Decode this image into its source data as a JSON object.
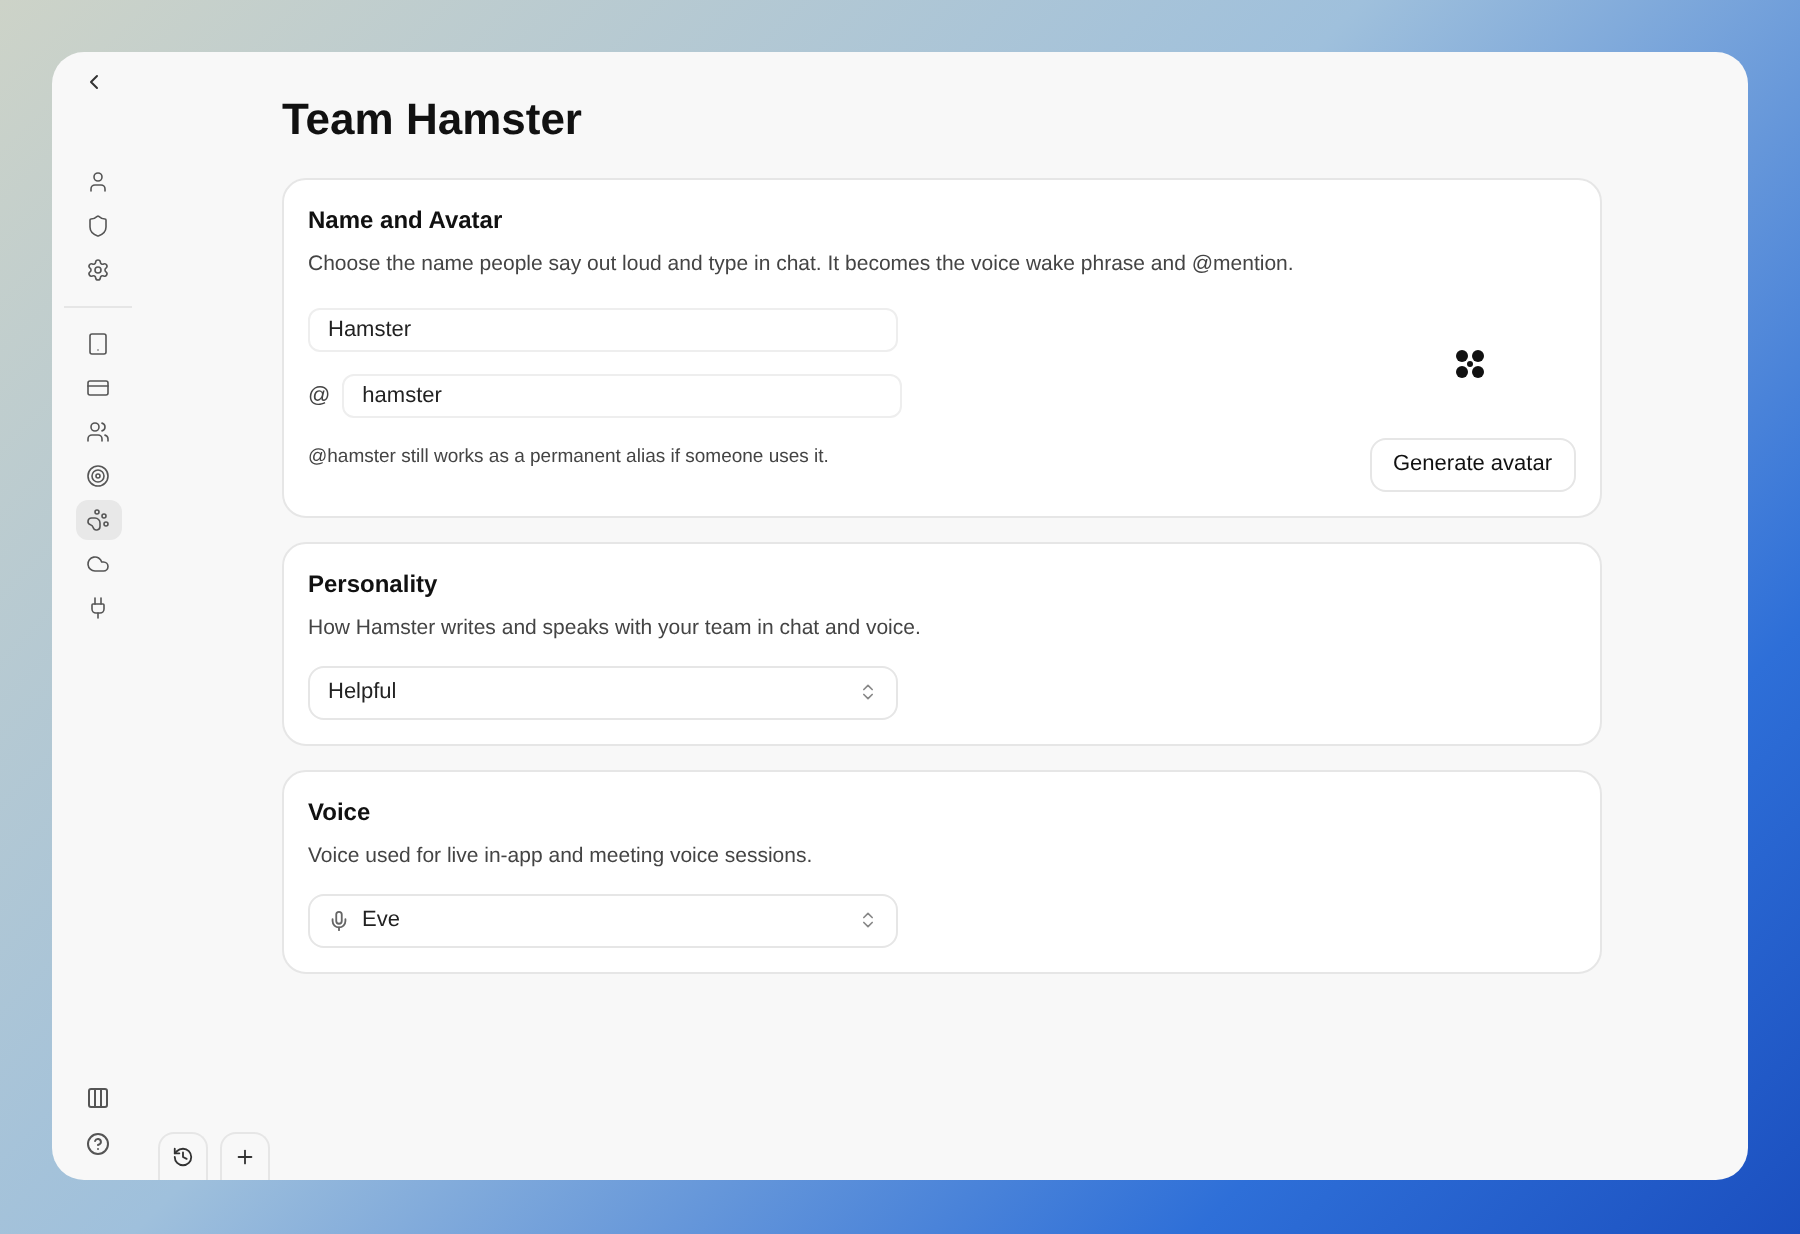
{
  "page": {
    "title": "Team Hamster"
  },
  "sidebar": {
    "top_items": [
      {
        "selected": false
      },
      {
        "selected": false
      },
      {
        "selected": false
      }
    ],
    "items": [
      {
        "selected": false
      },
      {
        "selected": false
      },
      {
        "selected": false
      },
      {
        "selected": false
      },
      {
        "selected": true
      },
      {
        "selected": false
      },
      {
        "selected": false
      }
    ]
  },
  "name_and_avatar": {
    "title": "Name and Avatar",
    "description": "Choose the name people say out loud and type in chat. It becomes the voice wake phrase and @mention.",
    "name_value": "Hamster",
    "handle_prefix": "@",
    "handle_value": "hamster",
    "note": "@hamster still works as a permanent alias if someone uses it.",
    "button": "Generate avatar"
  },
  "personality": {
    "title": "Personality",
    "description": "How Hamster writes and speaks with your team in chat and voice.",
    "value": "Helpful"
  },
  "voice": {
    "title": "Voice",
    "description": "Voice used for live in-app and meeting voice sessions.",
    "value": "Eve"
  }
}
